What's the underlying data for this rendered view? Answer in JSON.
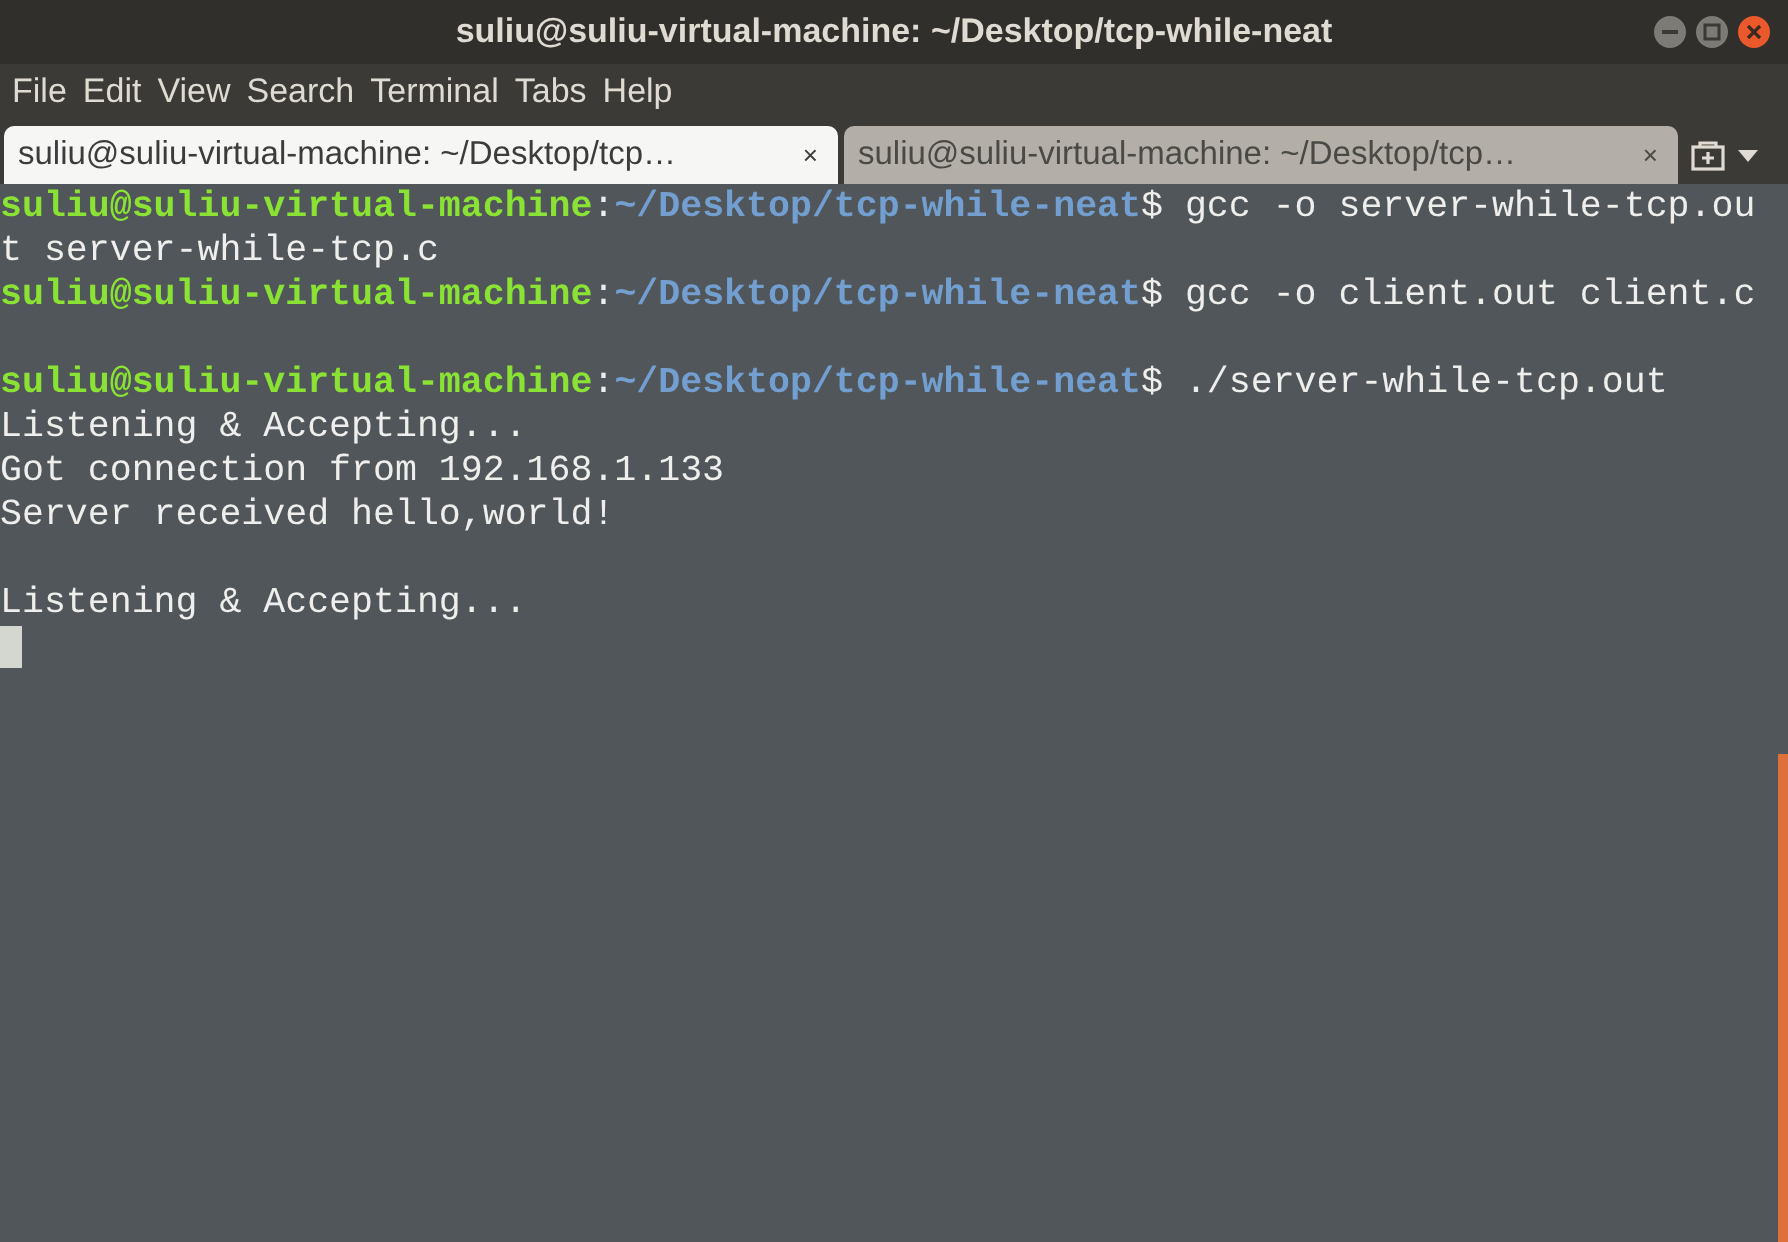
{
  "window": {
    "title": "suliu@suliu-virtual-machine: ~/Desktop/tcp-while-neat"
  },
  "menu": [
    "File",
    "Edit",
    "View",
    "Search",
    "Terminal",
    "Tabs",
    "Help"
  ],
  "tabs": [
    {
      "label": "suliu@suliu-virtual-machine: ~/Desktop/tcp…",
      "close": "×",
      "selected": true
    },
    {
      "label": "suliu@suliu-virtual-machine: ~/Desktop/tcp…",
      "close": "×",
      "selected": false
    }
  ],
  "terminal": {
    "lines": [
      {
        "kind": "prompt",
        "user_host": "suliu@suliu-virtual-machine",
        "separator": ":",
        "path": "~/Desktop/tcp-while-neat",
        "command": "$ gcc -o server-while-tcp.ou"
      },
      {
        "kind": "output",
        "text": "t server-while-tcp.c"
      },
      {
        "kind": "prompt",
        "user_host": "suliu@suliu-virtual-machine",
        "separator": ":",
        "path": "~/Desktop/tcp-while-neat",
        "command": "$ gcc -o client.out client.c"
      },
      {
        "kind": "blank"
      },
      {
        "kind": "prompt",
        "user_host": "suliu@suliu-virtual-machine",
        "separator": ":",
        "path": "~/Desktop/tcp-while-neat",
        "command": "$ ./server-while-tcp.out"
      },
      {
        "kind": "output",
        "text": "Listening & Accepting..."
      },
      {
        "kind": "output",
        "text": "Got connection from 192.168.1.133"
      },
      {
        "kind": "output",
        "text": "Server received hello,world!"
      },
      {
        "kind": "blank"
      },
      {
        "kind": "output",
        "text": "Listening & Accepting..."
      },
      {
        "kind": "cursor"
      }
    ]
  }
}
